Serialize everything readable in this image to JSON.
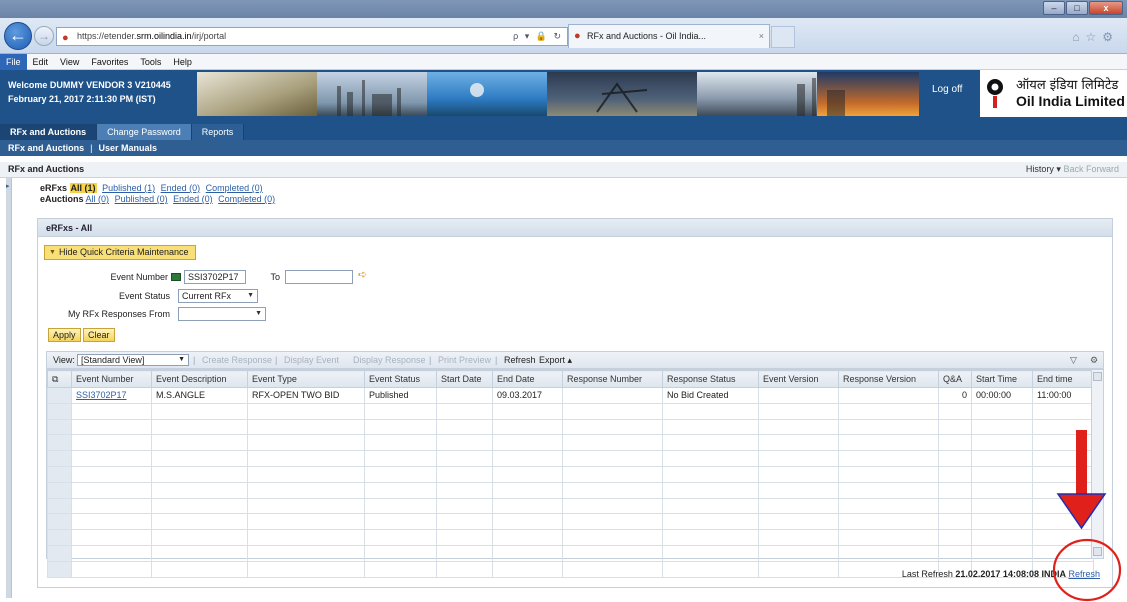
{
  "browser": {
    "url_prefix": "https://etender.",
    "url_host": "srm.oilindia.in",
    "url_path": "/irj/portal",
    "address_tools": "ρ ▾ 🔒 ↻",
    "tab_title": "RFx and Auctions - Oil India...",
    "tab_close": "×",
    "window_min": "–",
    "window_max": "□",
    "window_close": "x",
    "back_glyph": "←",
    "fwd_glyph": "→",
    "right_icons": "⌂☆⚙"
  },
  "menu": [
    "File",
    "Edit",
    "View",
    "Favorites",
    "Tools",
    "Help"
  ],
  "portal": {
    "welcome_line1": "Welcome DUMMY VENDOR 3 V210445",
    "welcome_line2": "February 21, 2017  2:11:30 PM (IST)",
    "log_off": "Log off",
    "logo_hindi": "ऑयल इंडिया लिमिटेड",
    "logo_en": "Oil India Limited",
    "tabs": [
      "RFx and Auctions",
      "Change Password",
      "Reports"
    ],
    "subnav": [
      "RFx and Auctions",
      "User Manuals"
    ],
    "subnav_sep": "|"
  },
  "page": {
    "title": "RFx and Auctions",
    "history": "History",
    "back": "Back",
    "forward": "Forward"
  },
  "queries": {
    "erfx_label": "eRFxs",
    "erfx_links": [
      "All (1)",
      "Published (1)",
      "Ended (0)",
      "Completed (0)"
    ],
    "eauction_label": "eAuctions",
    "eauction_links": [
      "All (0)",
      "Published (0)",
      "Ended (0)",
      "Completed (0)"
    ]
  },
  "panel": {
    "title": "eRFxs - All",
    "criteria_toggle": "Hide Quick Criteria Maintenance",
    "event_number_label": "Event Number",
    "event_number_value": "SSI3702P17",
    "to_label": "To",
    "to_value": "",
    "event_status_label": "Event Status",
    "event_status_value": "Current RFx",
    "responses_from_label": "My RFx Responses From",
    "responses_from_value": "",
    "apply": "Apply",
    "clear": "Clear"
  },
  "toolbar": {
    "view_label": "View:",
    "view_value": "[Standard View]",
    "create_response": "Create Response",
    "display_event": "Display Event",
    "display_response": "Display Response",
    "print_preview": "Print Preview",
    "refresh": "Refresh",
    "export": "Export ▴",
    "filter_icon": "▽",
    "settings_icon": "⚙"
  },
  "grid": {
    "columns": [
      "Event Number",
      "Event Description",
      "Event Type",
      "Event Status",
      "Start Date",
      "End Date",
      "Response Number",
      "Response Status",
      "Event Version",
      "Response Version",
      "Q&A",
      "Start Time",
      "End time"
    ],
    "rows": [
      [
        "SSI3702P17",
        "M.S.ANGLE",
        "RFX-OPEN TWO BID",
        "Published",
        "",
        "09.03.2017",
        "",
        "No Bid Created",
        "",
        "",
        "0",
        "00:00:00",
        "11:00:00"
      ]
    ],
    "empty_rows": 11
  },
  "footer": {
    "last_refresh_label": "Last Refresh",
    "last_refresh_value": "21.02.2017 14:08:08 INDIA",
    "refresh_link": "Refresh"
  },
  "colors": {
    "header_blue": "#1e5289",
    "highlight_yellow": "#f5d247",
    "annotation_red": "#e0201b"
  }
}
